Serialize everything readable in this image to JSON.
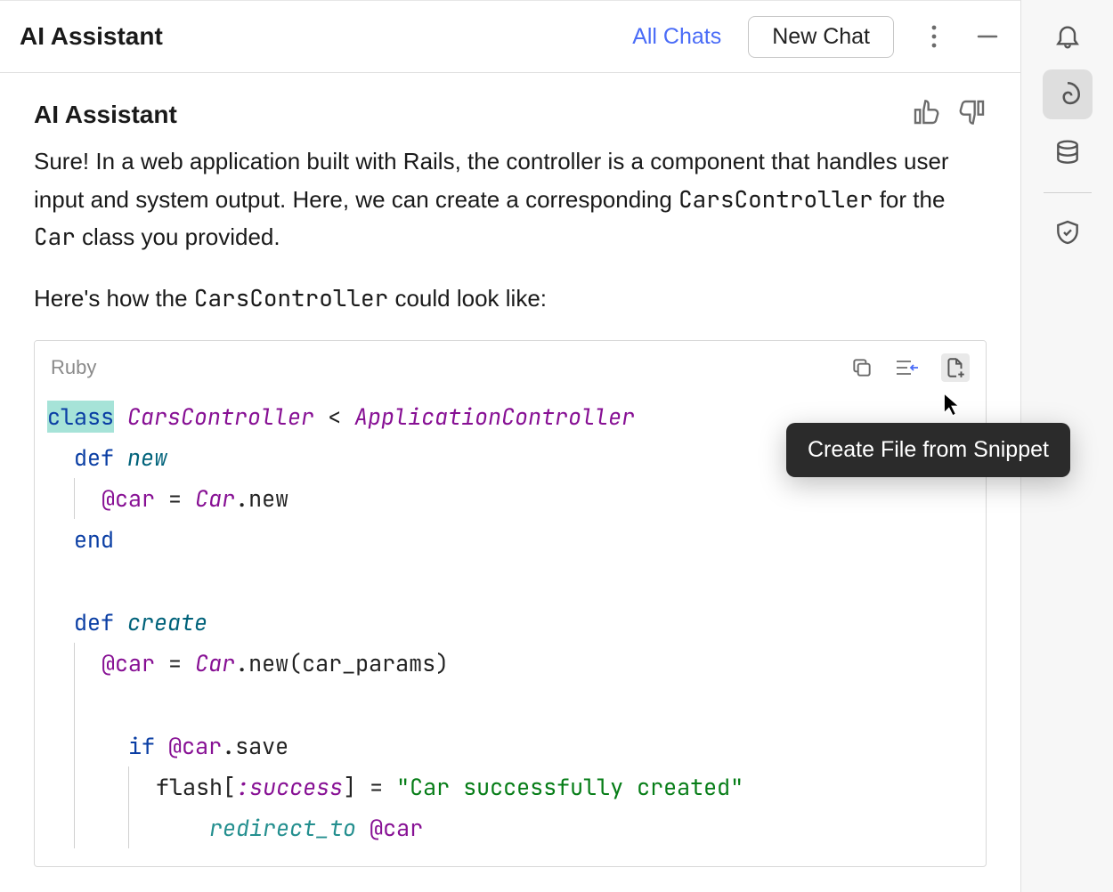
{
  "header": {
    "title": "AI Assistant",
    "all_chats": "All Chats",
    "new_chat": "New Chat"
  },
  "message": {
    "author": "AI Assistant",
    "para1_pre": "Sure! In a web application built with Rails, the controller is a component that handles user input and system output. Here, we can create a corresponding ",
    "para1_code1": "CarsController",
    "para1_mid": " for the ",
    "para1_code2": "Car",
    "para1_post": " class you provided.",
    "para2_pre": "Here's how the ",
    "para2_code": "CarsController",
    "para2_post": " could look like:"
  },
  "code": {
    "lang": "Ruby",
    "tokens": {
      "class": "class",
      "CarsController": "CarsController",
      "lt": "<",
      "ApplicationController": "ApplicationController",
      "def": "def",
      "new": "new",
      "ivar_car": "@car",
      "eq": " = ",
      "Car": "Car",
      "dot_new": ".new",
      "end": "end",
      "create": "create",
      "dot_new_params": ".new(car_params)",
      "if": "if",
      "dot_save": ".save",
      "flash": "flash[",
      "success_sym": ":success",
      "flash_close": "] = ",
      "str": "\"Car successfully created\"",
      "redirect_to": "redirect_to"
    }
  },
  "tooltip": "Create File from Snippet",
  "icons": {
    "kebab": "more-vertical",
    "minimize": "minimize",
    "thumbs_up": "thumbs-up",
    "thumbs_down": "thumbs-down",
    "copy": "copy",
    "insert": "insert-at-caret",
    "create_file": "create-file",
    "bell": "notifications",
    "swirl": "ai-assistant",
    "db": "database",
    "shield": "shield-check"
  }
}
